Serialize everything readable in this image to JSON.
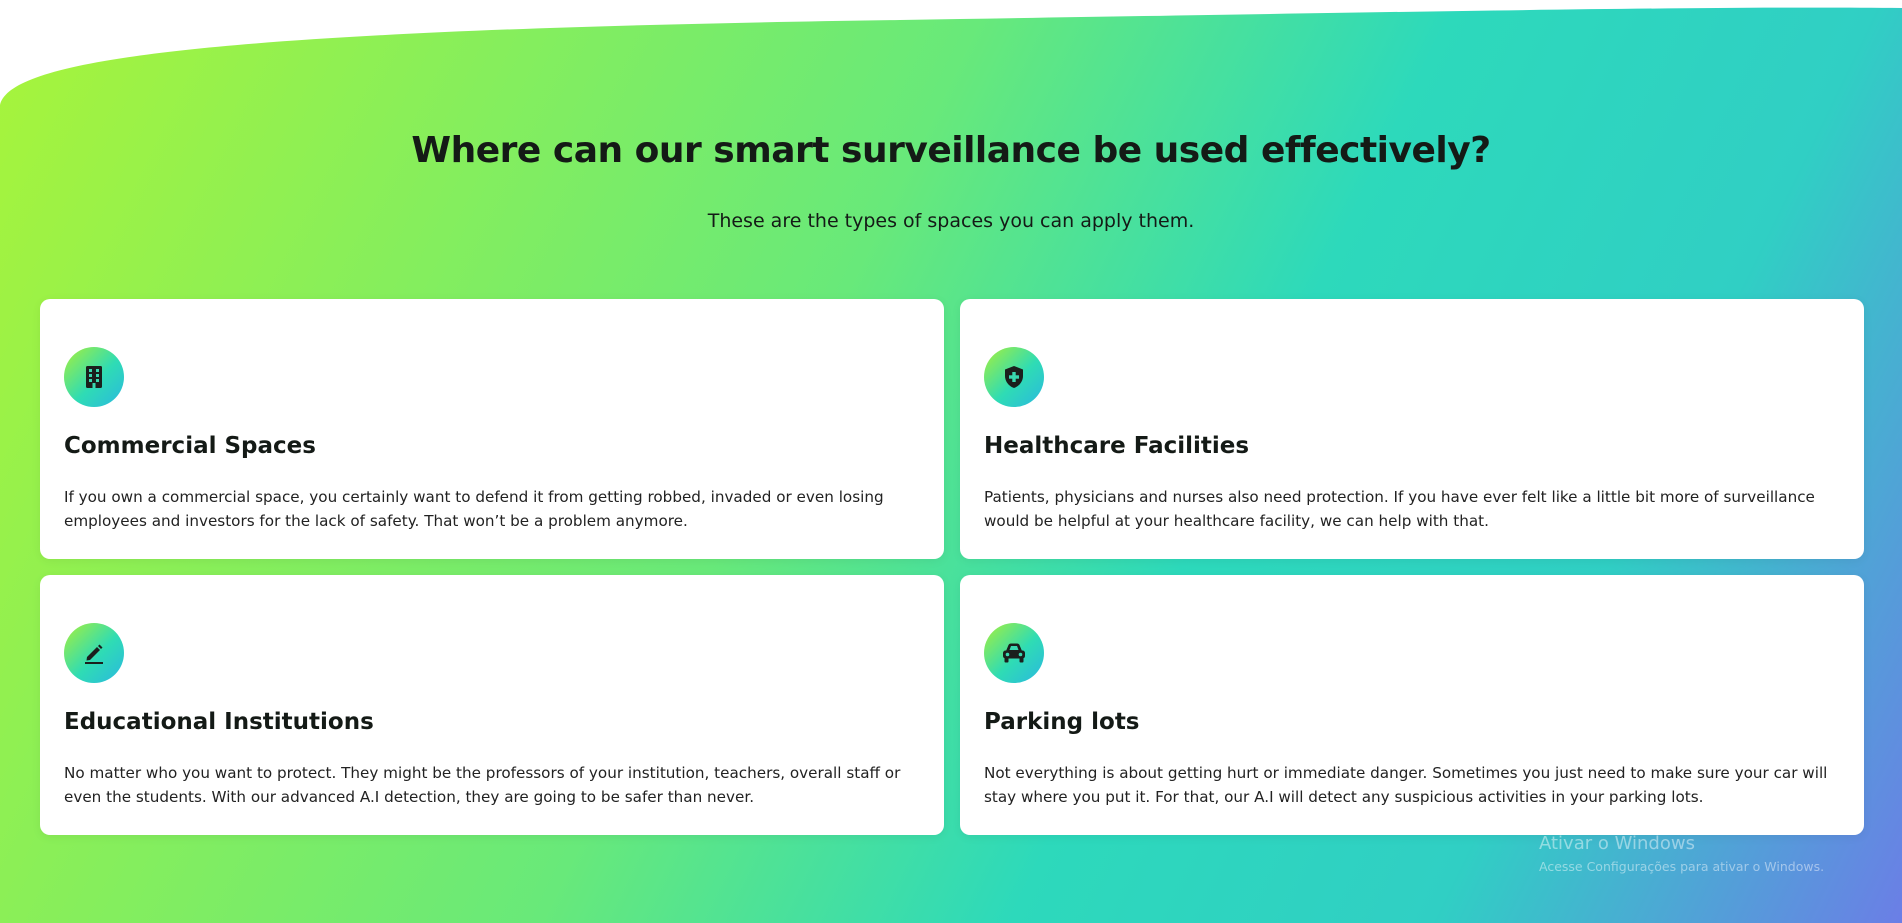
{
  "section": {
    "title": "Where can our smart surveillance be used effectively?",
    "subtitle": "These are the types of spaces you can apply them."
  },
  "cards": [
    {
      "icon": "building-icon",
      "title": "Commercial Spaces",
      "text": "If you own a commercial space, you certainly want to defend it from getting robbed, invaded or even losing employees and investors for the lack of safety. That won’t be a problem anymore."
    },
    {
      "icon": "shield-plus-icon",
      "title": "Healthcare Facilities",
      "text": "Patients, physicians and nurses also need protection. If you have ever felt like a little bit more of surveillance would be helpful at your healthcare facility, we can help with that."
    },
    {
      "icon": "pen-icon",
      "title": "Educational Institutions",
      "text": "No matter who you want to protect. They might be the professors of your institution, teachers, overall staff or even the students. With our advanced A.I detection, they are going to be safer than never."
    },
    {
      "icon": "car-icon",
      "title": "Parking lots",
      "text": "Not everything is about getting hurt or immediate danger. Sometimes you just need to make sure your car will stay where you put it. For that, our A.I will detect any suspicious activities in your parking lots."
    }
  ],
  "watermark": {
    "title": "Ativar o Windows",
    "subtitle": "Acesse Configurações para ativar o Windows."
  },
  "colors": {
    "gradient_start": "#a8f43a",
    "gradient_mid": "#2dd9bb",
    "gradient_end": "#6b7ee6",
    "text_dark": "#141a16",
    "card_bg": "#ffffff"
  }
}
